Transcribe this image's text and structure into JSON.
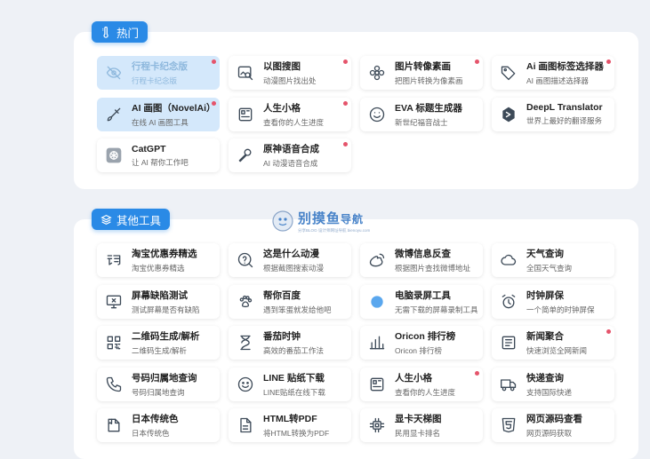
{
  "watermark": {
    "main": "别摸鱼",
    "sub": "导航",
    "small": "分享BLOG·设计师网址导航 bienoyu.com"
  },
  "hot": {
    "label": "热门",
    "items": [
      {
        "title": "行程卡纪念版",
        "desc": "行程卡纪念版",
        "icon": "eye-off-icon",
        "dot": true
      },
      {
        "title": "以图搜图",
        "desc": "动漫图片找出处",
        "icon": "image-search-icon",
        "dot": true
      },
      {
        "title": "图片转像素画",
        "desc": "把图片转换为像素画",
        "icon": "flower-icon",
        "dot": true
      },
      {
        "title": "Ai 画图标签选择器",
        "desc": "AI 画图描述选择器",
        "icon": "tags-icon",
        "dot": true
      },
      {
        "title": "AI 画图（NovelAi）",
        "desc": "在线 AI 画图工具",
        "icon": "brush-icon",
        "dot": true
      },
      {
        "title": "人生小格",
        "desc": "查看你的人生进度",
        "icon": "grid-box-icon",
        "dot": true
      },
      {
        "title": "EVA 标题生成器",
        "desc": "新世纪福音战士",
        "icon": "smile-icon",
        "dot": false
      },
      {
        "title": "DeepL Translator",
        "desc": "世界上最好的翻译服务",
        "icon": "deepl-icon",
        "dot": false
      },
      {
        "title": "CatGPT",
        "desc": "让 AI 帮你工作吧",
        "icon": "openai-icon",
        "dot": false
      },
      {
        "title": "原神语音合成",
        "desc": "AI 动漫语音合成",
        "icon": "microphone-icon",
        "dot": true
      }
    ]
  },
  "other": {
    "label": "其他工具",
    "items": [
      {
        "title": "淘宝优惠券精选",
        "desc": "淘宝优惠券精选",
        "icon": "taobao-icon",
        "dot": false
      },
      {
        "title": "这是什么动漫",
        "desc": "根据截图搜索动漫",
        "icon": "question-icon",
        "dot": false
      },
      {
        "title": "微博信息反查",
        "desc": "根据图片查找微博地址",
        "icon": "weibo-icon",
        "dot": false
      },
      {
        "title": "天气查询",
        "desc": "全国天气查询",
        "icon": "cloud-icon",
        "dot": false
      },
      {
        "title": "屏幕缺陷测试",
        "desc": "测试屏幕是否有缺陷",
        "icon": "monitor-x-icon",
        "dot": false
      },
      {
        "title": "帮你百度",
        "desc": "遇到笨蛋就发给他吧",
        "icon": "paw-icon",
        "dot": false
      },
      {
        "title": "电脑录屏工具",
        "desc": "无需下载的屏幕录制工具",
        "icon": "record-icon",
        "dot": false
      },
      {
        "title": "时钟屏保",
        "desc": "一个简单的时钟屏保",
        "icon": "alarm-icon",
        "dot": false
      },
      {
        "title": "二维码生成/解析",
        "desc": "二维码生成/解析",
        "icon": "qrcode-icon",
        "dot": false
      },
      {
        "title": "番茄时钟",
        "desc": "高效的番茄工作法",
        "icon": "hourglass-icon",
        "dot": false
      },
      {
        "title": "Oricon 排行榜",
        "desc": "Oricon 排行榜",
        "icon": "bar-chart-icon",
        "dot": false
      },
      {
        "title": "新闻聚合",
        "desc": "快速浏览全网新闻",
        "icon": "news-icon",
        "dot": true
      },
      {
        "title": "号码归属地查询",
        "desc": "号码归属地查询",
        "icon": "phone-icon",
        "dot": false
      },
      {
        "title": "LINE 贴纸下载",
        "desc": "LINE贴纸在线下载",
        "icon": "emoji-icon",
        "dot": false
      },
      {
        "title": "人生小格",
        "desc": "查看你的人生进度",
        "icon": "grid-box-icon",
        "dot": true
      },
      {
        "title": "快递查询",
        "desc": "支持国际快递",
        "icon": "truck-icon",
        "dot": false
      },
      {
        "title": "日本传统色",
        "desc": "日本传统色",
        "icon": "palette-book-icon",
        "dot": false
      },
      {
        "title": "HTML转PDF",
        "desc": "将HTML转换为PDF",
        "icon": "file-icon",
        "dot": false
      },
      {
        "title": "显卡天梯图",
        "desc": "民用显卡排名",
        "icon": "chip-icon",
        "dot": false
      },
      {
        "title": "网页源码查看",
        "desc": "网页源码获取",
        "icon": "html5-icon",
        "dot": false
      }
    ]
  }
}
